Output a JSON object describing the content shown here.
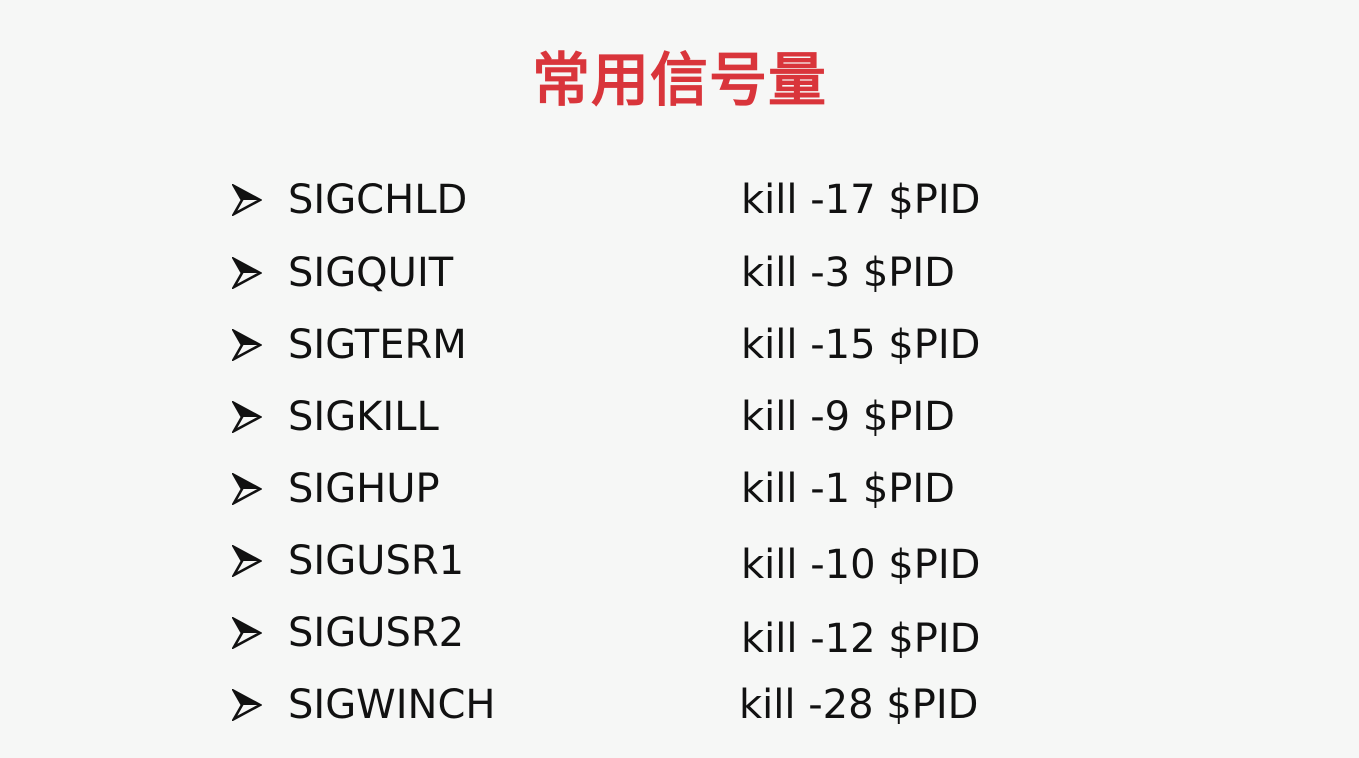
{
  "title": "常用信号量",
  "colors": {
    "title": "#d9353b",
    "text": "#111111",
    "background": "#f6f7f6"
  },
  "bullet_icon": "arrowhead-bullet-icon",
  "signals": [
    {
      "name": "SIGCHLD",
      "command": "kill -17 $PID"
    },
    {
      "name": "SIGQUIT",
      "command": "kill -3 $PID"
    },
    {
      "name": "SIGTERM",
      "command": "kill -15 $PID"
    },
    {
      "name": "SIGKILL",
      "command": "kill -9 $PID"
    },
    {
      "name": "SIGHUP",
      "command": "kill -1 $PID"
    },
    {
      "name": "SIGUSR1",
      "command": "kill -10 $PID"
    },
    {
      "name": "SIGUSR2",
      "command": "kill -12 $PID"
    },
    {
      "name": "SIGWINCH",
      "command": "kill -28 $PID"
    }
  ]
}
